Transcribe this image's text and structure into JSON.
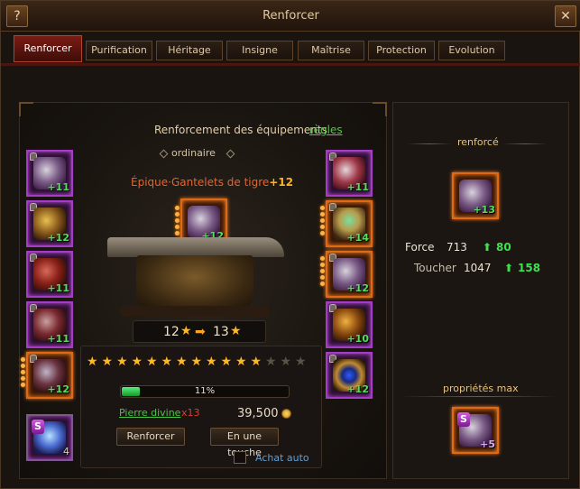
{
  "window": {
    "title": "Renforcer",
    "help_label": "?",
    "close_label": "✕"
  },
  "tabs": [
    {
      "label": "Renforcer",
      "active": true
    },
    {
      "label": "Purification"
    },
    {
      "label": "Héritage"
    },
    {
      "label": "Insigne"
    },
    {
      "label": "Maîtrise"
    },
    {
      "label": "Protection"
    },
    {
      "label": "Evolution"
    }
  ],
  "main": {
    "heading": "Renforcement des équipements",
    "rules_link": "règles",
    "quality": "ordinaire",
    "item_prefix": "Épique·Gantelets de tigre",
    "item_level": "+12",
    "selected_item_level": "+12",
    "left_slots": [
      {
        "name": "helmet",
        "plus": "+11",
        "locked": true
      },
      {
        "name": "necklace",
        "plus": "+12",
        "locked": true
      },
      {
        "name": "armor",
        "plus": "+11",
        "locked": true
      },
      {
        "name": "belt",
        "plus": "+11",
        "locked": true
      },
      {
        "name": "boots",
        "plus": "+12",
        "locked": true,
        "highlight": true
      }
    ],
    "right_slots": [
      {
        "name": "shoulder",
        "plus": "+11",
        "locked": true
      },
      {
        "name": "amulet",
        "plus": "+14",
        "locked": true
      },
      {
        "name": "gauntlets",
        "plus": "+12",
        "locked": true,
        "highlight": true
      },
      {
        "name": "bracer",
        "plus": "+10",
        "locked": true
      },
      {
        "name": "ring",
        "plus": "+12",
        "locked": true
      }
    ],
    "wings_slot": {
      "name": "wings",
      "badge": "S",
      "count": "4"
    },
    "level_from": "12",
    "level_to": "13",
    "stars_total": 15,
    "stars_filled": 12,
    "progress_percent": 11,
    "progress_label": "11%",
    "stone_label": "Pierre divine",
    "stone_multiplier": "x13",
    "cost": "39,500",
    "btn_enhance": "Renforcer",
    "btn_one_click": "En une touche",
    "auto_buy_label": "Achat auto"
  },
  "right_panel": {
    "enhanced_label": "renforcé",
    "enhanced_item_plus": "+13",
    "stats": [
      {
        "name": "Force",
        "value": "713",
        "gain": "80"
      },
      {
        "name": "Toucher",
        "value": "1047",
        "gain": "158"
      }
    ],
    "max_label": "propriétés max",
    "max_item_badge": "S",
    "max_item_plus": "+5"
  },
  "colors": {
    "accent_red": "#7a1c14",
    "green_gain": "#3fe04f",
    "item_name": "#e5642c",
    "gold": "#ffb820"
  }
}
